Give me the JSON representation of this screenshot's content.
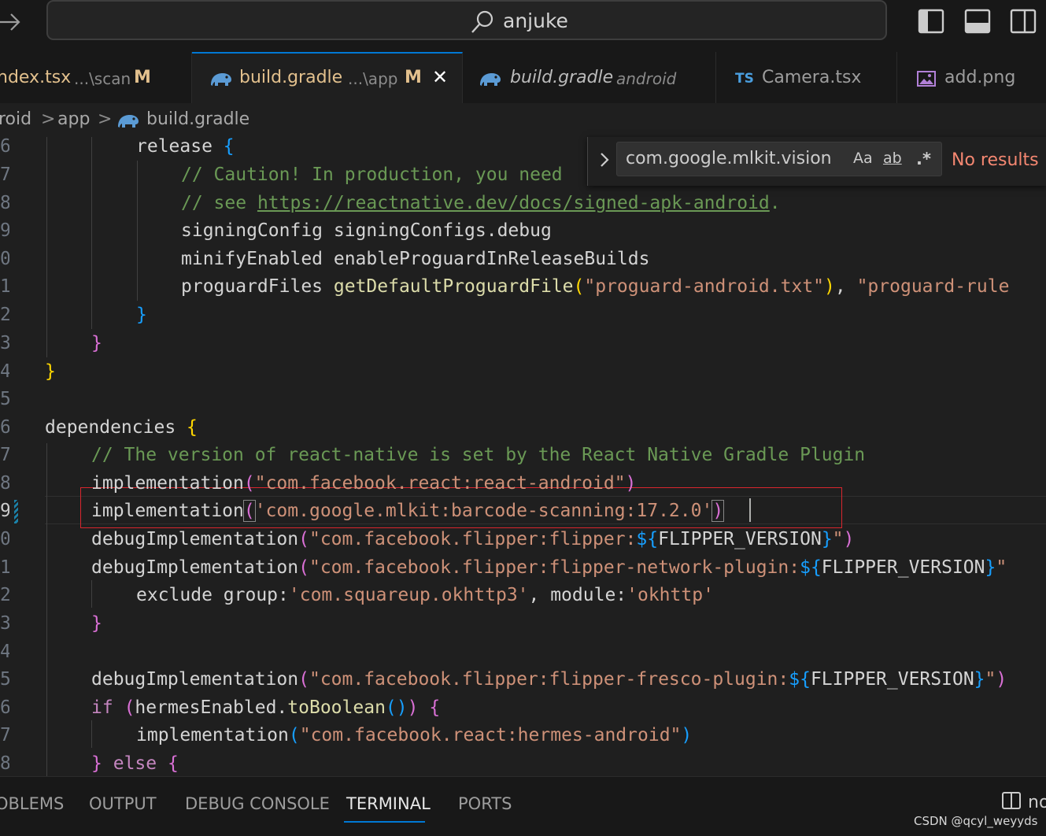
{
  "titlebar": {
    "search_text": "anjuke"
  },
  "tabs": [
    {
      "name": "ndex.tsx",
      "desc": "...\\scan",
      "status": "M"
    },
    {
      "name": "build.gradle",
      "desc": "...\\app",
      "status": "M",
      "close": "✕"
    },
    {
      "name": "build.gradle",
      "desc": "android"
    },
    {
      "badge": "TS",
      "name": "Camera.tsx"
    },
    {
      "name": "add.png"
    }
  ],
  "breadcrumb": {
    "part1": "roid",
    "part2": "app",
    "part3": "build.gradle",
    "sep": ">"
  },
  "gutter": [
    "6",
    "7",
    "8",
    "9",
    "0",
    "1",
    "2",
    "3",
    "4",
    "5",
    "6",
    "7",
    "8",
    "9",
    "0",
    "1",
    "2",
    "3",
    "4",
    "5",
    "6",
    "7",
    "8"
  ],
  "code": {
    "l1": {
      "a": "release",
      "b": "{"
    },
    "l2": "// Caution! In production, you need",
    "l3": {
      "a": "// see ",
      "link": "https://reactnative.dev/docs/signed-apk-android",
      "b": "."
    },
    "l4": "signingConfig signingConfigs.debug",
    "l5": "minifyEnabled enableProguardInReleaseBuilds",
    "l6": {
      "a": "proguardFiles ",
      "fn": "getDefaultProguardFile",
      "p1": "(",
      "s1": "\"proguard-android.txt\"",
      "p2": ")",
      "c": ", ",
      "s2": "\"proguard-rule"
    },
    "l7": "}",
    "l8": "}",
    "l9": "}",
    "l11": {
      "a": "dependencies",
      "b": "{"
    },
    "l12": "// The version of react-native is set by the React Native Gradle Plugin",
    "l13": {
      "a": "implementation",
      "p1": "(",
      "s": "\"com.facebook.react:react-android\"",
      "p2": ")"
    },
    "l14": {
      "a": "implementation",
      "p1": "(",
      "s": "'com.google.mlkit:barcode-scanning:17.2.0'",
      "p2": ")"
    },
    "l15": {
      "a": "debugImplementation",
      "p1": "(",
      "s": "\"com.facebook.flipper:flipper:",
      "d": "${",
      "v": "FLIPPER_VERSION",
      "e": "}",
      "s2": "\"",
      "p2": ")"
    },
    "l16": {
      "a": "debugImplementation",
      "p1": "(",
      "s": "\"com.facebook.flipper:flipper-network-plugin:",
      "d": "${",
      "v": "FLIPPER_VERSION",
      "e": "}",
      "s2": "\""
    },
    "l17": {
      "a": "exclude group:",
      "s1": "'com.squareup.okhttp3'",
      "c": ", module:",
      "s2": "'okhttp'"
    },
    "l18": "}",
    "l20": {
      "a": "debugImplementation",
      "p1": "(",
      "s": "\"com.facebook.flipper:flipper-fresco-plugin:",
      "d": "${",
      "v": "FLIPPER_VERSION",
      "e": "}",
      "s2": "\"",
      "p2": ")"
    },
    "l21": {
      "kw": "if",
      "p1": "(",
      "a": "hermesEnabled.",
      "fn": "toBoolean",
      "p2": "()",
      "p3": ")",
      "b": "{"
    },
    "l22": {
      "a": "implementation",
      "p1": "(",
      "s": "\"com.facebook.react:hermes-android\"",
      "p2": ")"
    },
    "l23": {
      "a": "}",
      "kw": "else",
      "b": "{"
    }
  },
  "find": {
    "value": "com.google.mlkit.vision.DI",
    "opt_case": "Aa",
    "opt_word": "ab",
    "opt_regex": ".*",
    "result": "No results"
  },
  "panel": {
    "tabs": [
      "OBLEMS",
      "OUTPUT",
      "DEBUG CONSOLE",
      "TERMINAL",
      "PORTS"
    ],
    "extra": "no"
  },
  "watermark": "CSDN @qcyl_weyyds",
  "colors": {
    "accent": "#0078d4",
    "modified": "#e2c08d",
    "no_results": "#f48771",
    "highlight_box": "#d9262e"
  }
}
